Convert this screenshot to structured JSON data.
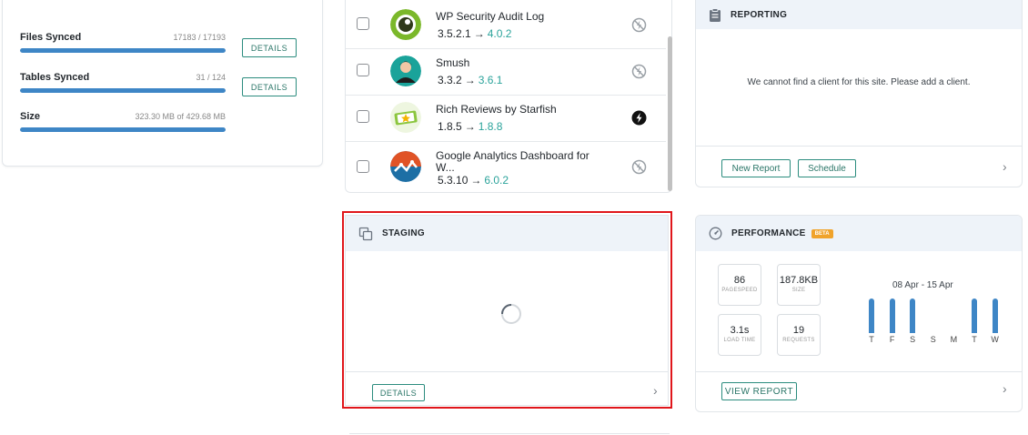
{
  "sync": {
    "files": {
      "label": "Files Synced",
      "value": "17183 / 17193",
      "progress": 0.999,
      "button": "DETAILS"
    },
    "tables": {
      "label": "Tables Synced",
      "value": "31 / 124",
      "progress": 1.0,
      "button": "DETAILS"
    },
    "size": {
      "label": "Size",
      "value": "323.30 MB of 429.68 MB",
      "progress": 1.0
    }
  },
  "plugins": [
    {
      "name": "WP Security Audit Log",
      "current": "3.5.2.1",
      "latest": "4.0.2",
      "status_icon": "update-disabled-icon"
    },
    {
      "name": "Smush",
      "current": "3.3.2",
      "latest": "3.6.1",
      "status_icon": "update-disabled-icon"
    },
    {
      "name": "Rich Reviews by Starfish",
      "current": "1.8.5",
      "latest": "1.8.8",
      "status_icon": "lightning-icon"
    },
    {
      "name": "Google Analytics Dashboard for W...",
      "current": "5.3.10",
      "latest": "6.0.2",
      "status_icon": "update-disabled-icon"
    }
  ],
  "staging": {
    "title": "STAGING",
    "button": "DETAILS"
  },
  "reporting": {
    "title": "REPORTING",
    "message": "We cannot find a client for this site. Please add a client.",
    "new_report": "New Report",
    "schedule": "Schedule"
  },
  "performance": {
    "title": "PERFORMANCE",
    "badge": "BETA",
    "metrics": [
      {
        "value": "86",
        "label": "PAGESPEED"
      },
      {
        "value": "187.8KB",
        "label": "SIZE"
      },
      {
        "value": "3.1s",
        "label": "LOAD TIME"
      },
      {
        "value": "19",
        "label": "REQUESTS"
      }
    ],
    "range": "08 Apr - 15 Apr",
    "days": [
      {
        "label": "T",
        "level": 1
      },
      {
        "label": "F",
        "level": 1
      },
      {
        "label": "S",
        "level": 1
      },
      {
        "label": "S",
        "level": 0
      },
      {
        "label": "M",
        "level": 0
      },
      {
        "label": "T",
        "level": 1
      },
      {
        "label": "W",
        "level": 1
      }
    ],
    "view_report": "VIEW REPORT"
  },
  "colors": {
    "accent": "#2ba39b",
    "bar": "#3e86c6",
    "highlight": "#e0161b",
    "beta": "#f0a32b"
  }
}
